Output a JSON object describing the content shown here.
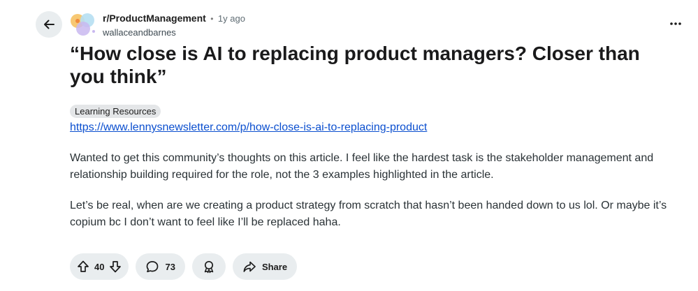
{
  "post": {
    "subreddit": "r/ProductManagement",
    "separator": "•",
    "time_ago": "1y ago",
    "author": "wallaceandbarnes",
    "title": "“How close is AI to replacing product managers? Closer than you think”",
    "flair": "Learning Resources",
    "link": "https://www.lennysnewsletter.com/p/how-close-is-ai-to-replacing-product",
    "body": [
      "Wanted to get this community’s thoughts on this article. I feel like the hardest task is the stakeholder management and relationship building required for the role, not the 3 examples highlighted in the article.",
      "Let’s be real, when are we creating a product strategy from scratch that hasn’t been handed down to us lol. Or maybe it’s copium bc I don’t want to feel like I’ll be replaced haha."
    ]
  },
  "actions": {
    "vote_count": "40",
    "comment_count": "73",
    "share_label": "Share"
  },
  "icons": {
    "back": "arrow-left-icon",
    "more": "more-horizontal-icon",
    "upvote": "arrow-up-icon",
    "downvote": "arrow-down-icon",
    "comment": "comment-bubble-icon",
    "award": "award-icon",
    "share": "share-arrow-icon"
  },
  "colors": {
    "link": "#0b4fcf",
    "pill_bg": "#e9edef"
  }
}
